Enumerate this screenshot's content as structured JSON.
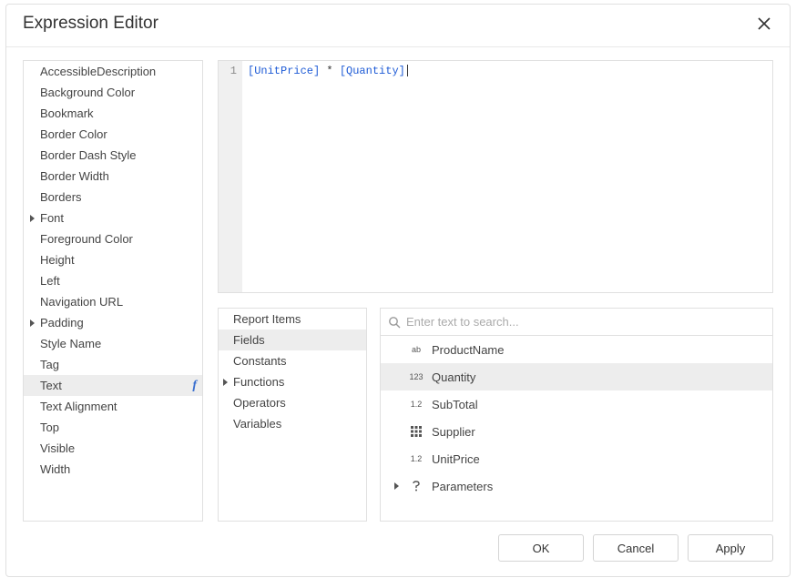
{
  "dialog": {
    "title": "Expression Editor"
  },
  "properties": [
    {
      "label": "AccessibleDescription",
      "expandable": false,
      "selected": false,
      "hasFx": false
    },
    {
      "label": "Background Color",
      "expandable": false,
      "selected": false,
      "hasFx": false
    },
    {
      "label": "Bookmark",
      "expandable": false,
      "selected": false,
      "hasFx": false
    },
    {
      "label": "Border Color",
      "expandable": false,
      "selected": false,
      "hasFx": false
    },
    {
      "label": "Border Dash Style",
      "expandable": false,
      "selected": false,
      "hasFx": false
    },
    {
      "label": "Border Width",
      "expandable": false,
      "selected": false,
      "hasFx": false
    },
    {
      "label": "Borders",
      "expandable": false,
      "selected": false,
      "hasFx": false
    },
    {
      "label": "Font",
      "expandable": true,
      "selected": false,
      "hasFx": false
    },
    {
      "label": "Foreground Color",
      "expandable": false,
      "selected": false,
      "hasFx": false
    },
    {
      "label": "Height",
      "expandable": false,
      "selected": false,
      "hasFx": false
    },
    {
      "label": "Left",
      "expandable": false,
      "selected": false,
      "hasFx": false
    },
    {
      "label": "Navigation URL",
      "expandable": false,
      "selected": false,
      "hasFx": false
    },
    {
      "label": "Padding",
      "expandable": true,
      "selected": false,
      "hasFx": false
    },
    {
      "label": "Style Name",
      "expandable": false,
      "selected": false,
      "hasFx": false
    },
    {
      "label": "Tag",
      "expandable": false,
      "selected": false,
      "hasFx": false
    },
    {
      "label": "Text",
      "expandable": false,
      "selected": true,
      "hasFx": true
    },
    {
      "label": "Text Alignment",
      "expandable": false,
      "selected": false,
      "hasFx": false
    },
    {
      "label": "Top",
      "expandable": false,
      "selected": false,
      "hasFx": false
    },
    {
      "label": "Visible",
      "expandable": false,
      "selected": false,
      "hasFx": false
    },
    {
      "label": "Width",
      "expandable": false,
      "selected": false,
      "hasFx": false
    }
  ],
  "editor": {
    "lineNumber": "1",
    "tokens": {
      "f1": "[UnitPrice]",
      "op": " * ",
      "f2": "[Quantity]"
    }
  },
  "categories": [
    {
      "label": "Report Items",
      "expandable": false,
      "selected": false
    },
    {
      "label": "Fields",
      "expandable": false,
      "selected": true
    },
    {
      "label": "Constants",
      "expandable": false,
      "selected": false
    },
    {
      "label": "Functions",
      "expandable": true,
      "selected": false
    },
    {
      "label": "Operators",
      "expandable": false,
      "selected": false
    },
    {
      "label": "Variables",
      "expandable": false,
      "selected": false
    }
  ],
  "search": {
    "placeholder": "Enter text to search..."
  },
  "fields": [
    {
      "label": "ProductName",
      "iconType": "abc",
      "icon": "ab",
      "selected": false,
      "hasChevron": false
    },
    {
      "label": "Quantity",
      "iconType": "123",
      "icon": "123",
      "selected": true,
      "hasChevron": false
    },
    {
      "label": "SubTotal",
      "iconType": "dec",
      "icon": "1.2",
      "selected": false,
      "hasChevron": false
    },
    {
      "label": "Supplier",
      "iconType": "grid",
      "icon": "grid",
      "selected": false,
      "hasChevron": false
    },
    {
      "label": "UnitPrice",
      "iconType": "dec",
      "icon": "1.2",
      "selected": false,
      "hasChevron": false
    },
    {
      "label": "Parameters",
      "iconType": "question",
      "icon": "?",
      "selected": false,
      "hasChevron": true
    }
  ],
  "buttons": {
    "ok": "OK",
    "cancel": "Cancel",
    "apply": "Apply"
  }
}
